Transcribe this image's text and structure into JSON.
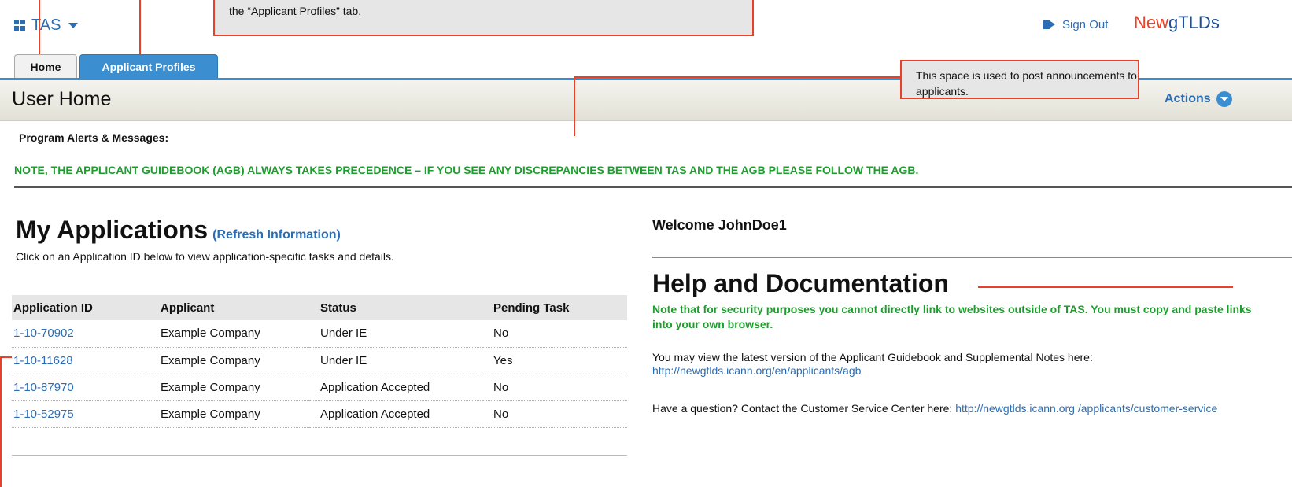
{
  "header": {
    "app_name": "TAS",
    "sign_out_label": "Sign Out",
    "logo_part1": "New",
    "logo_part2": "gTLDs"
  },
  "tabs": [
    {
      "label": "Home",
      "active": true
    },
    {
      "label": "Applicant Profiles",
      "active": false
    }
  ],
  "page": {
    "title": "User Home",
    "actions_label": "Actions"
  },
  "alerts": {
    "label": "Program Alerts & Messages:",
    "note": "NOTE, THE APPLICANT GUIDEBOOK (AGB) ALWAYS TAKES PRECEDENCE – IF YOU SEE ANY DISCREPANCIES BETWEEN TAS AND THE AGB PLEASE FOLLOW THE AGB."
  },
  "applications": {
    "title": "My Applications",
    "refresh_label": "(Refresh Information)",
    "subtitle": "Click on an Application ID below to view application-specific tasks and details.",
    "columns": [
      "Application ID",
      "Applicant",
      "Status",
      "Pending Task"
    ],
    "rows": [
      {
        "id": "1-10-70902",
        "applicant": "Example Company",
        "status": "Under IE",
        "pending": "No"
      },
      {
        "id": "1-10-11628",
        "applicant": "Example Company",
        "status": "Under IE",
        "pending": "Yes"
      },
      {
        "id": "1-10-87970",
        "applicant": "Example Company",
        "status": "Application Accepted",
        "pending": "No"
      },
      {
        "id": "1-10-52975",
        "applicant": "Example Company",
        "status": "Application Accepted",
        "pending": "No"
      }
    ]
  },
  "welcome": "Welcome JohnDoe1",
  "help": {
    "title": "Help and Documentation",
    "note": "Note that for security purposes you cannot directly link to websites outside of TAS.  You must copy and paste links into your own browser.",
    "p1_text": "You may view the latest version of the Applicant Guidebook and Supplemental Notes here:",
    "p1_link": "http://newgtlds.icann.org/en/applicants/agb",
    "p2_text": "Have a question?  Contact the Customer Service Center here:",
    "p2_link": "http://newgtlds.icann.org /applicants/customer-service"
  },
  "callouts": {
    "top_line2": "the “Applicant Profiles” tab.",
    "announcements": "This space is used to post announcements to applicants."
  },
  "colors": {
    "link_blue": "#2a6db5",
    "tab_blue": "#3b8fd1",
    "alert_green": "#1e9d2e",
    "callout_red": "#e4432a"
  }
}
